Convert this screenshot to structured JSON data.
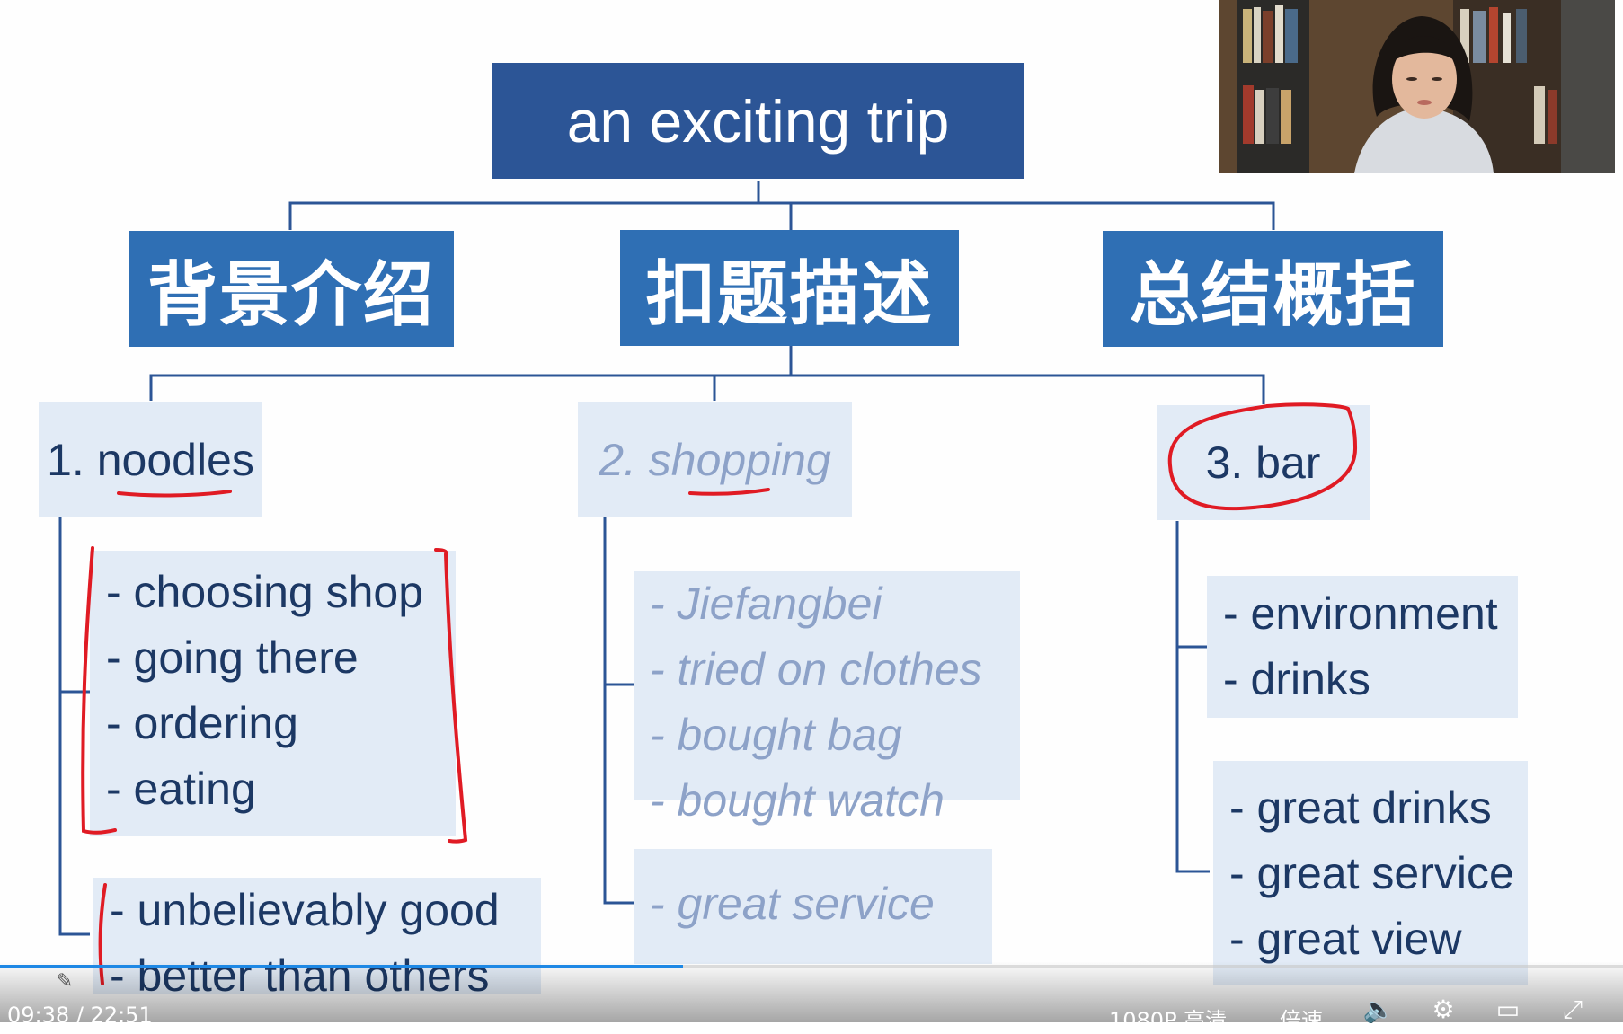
{
  "slide": {
    "root": "an exciting trip",
    "categories": [
      "背景介绍",
      "扣题描述",
      "总结概括"
    ],
    "branches": [
      {
        "label": "1. noodles",
        "lists": [
          [
            "- choosing shop",
            "- going there",
            "- ordering",
            "- eating"
          ],
          [
            "- unbelievably good",
            "- better than others"
          ]
        ]
      },
      {
        "label": "2. shopping",
        "lists": [
          [
            "- Jiefangbei",
            "- tried on clothes",
            "- bought bag",
            "- bought watch"
          ],
          [
            "- great service"
          ]
        ]
      },
      {
        "label": "3. bar",
        "lists": [
          [
            "- environment",
            "- drinks"
          ],
          [
            "- great drinks",
            "- great service",
            "- great view"
          ]
        ]
      }
    ]
  },
  "colors": {
    "root": "#2c5596",
    "category": "#2f6fb4",
    "subbox": "#e2ebf6",
    "annotation": "#e01b24",
    "progress": "#1e88e5"
  },
  "player": {
    "current_time": "09:38",
    "separator": "/",
    "duration": "22:51",
    "progress": 0.421,
    "quality": "1080P 高清",
    "speed": "倍速",
    "icons": [
      "pencil-icon",
      "volume-icon",
      "settings-icon",
      "pip-icon",
      "fullscreen-icon"
    ]
  }
}
